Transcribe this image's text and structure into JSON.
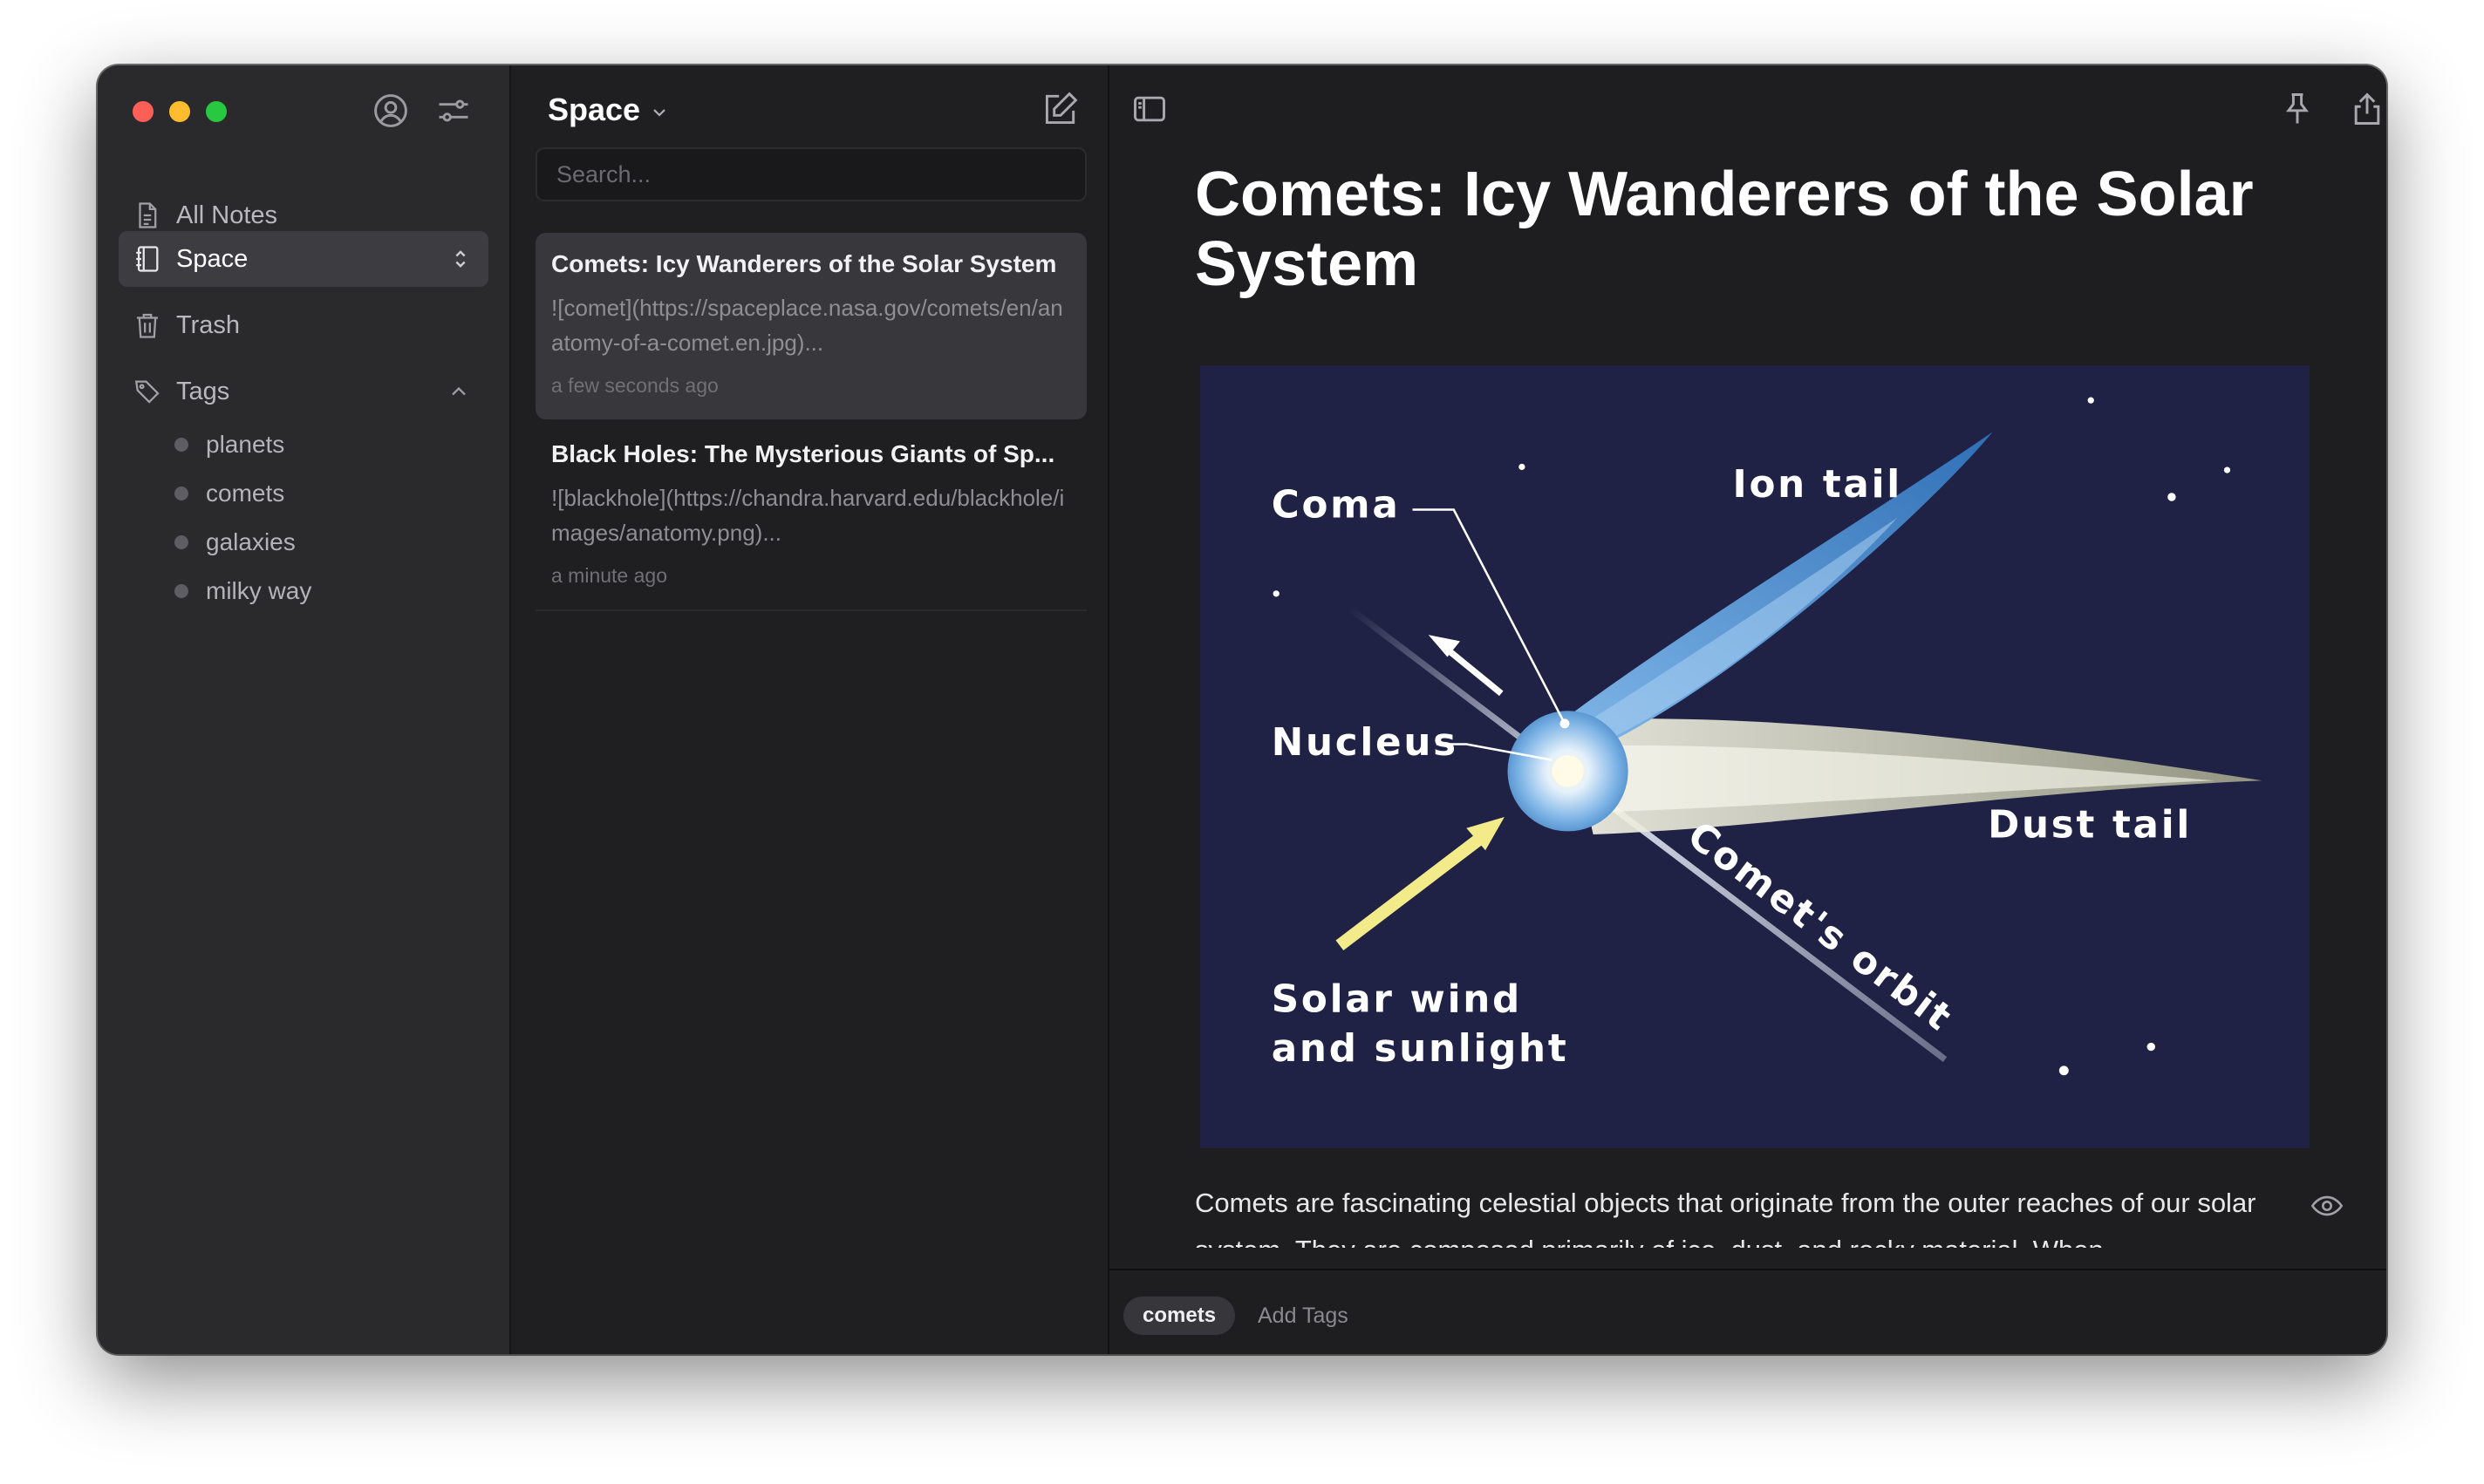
{
  "window": {
    "traffic_lights": [
      "close",
      "minimize",
      "zoom"
    ]
  },
  "sidebar": {
    "header_icons": [
      "account-icon",
      "settings-sliders-icon"
    ],
    "items": [
      {
        "label": "All Notes",
        "icon": "document-icon"
      },
      {
        "label": "Space",
        "icon": "notebook-icon",
        "active": true
      },
      {
        "label": "Trash",
        "icon": "trash-icon"
      }
    ],
    "tags_header": "Tags",
    "tags": [
      "planets",
      "comets",
      "galaxies",
      "milky way"
    ]
  },
  "notes_list": {
    "title": "Space",
    "search_placeholder": "Search...",
    "notes": [
      {
        "title": "Comets: Icy Wanderers of the Solar System",
        "excerpt": "![comet](https://spaceplace.nasa.gov/comets/en/anatomy-of-a-comet.en.jpg)...",
        "time": "a few seconds ago",
        "selected": true
      },
      {
        "title": "Black Holes: The Mysterious Giants of Sp...",
        "excerpt": "![blackhole](https://chandra.harvard.edu/blackhole/images/anatomy.png)...",
        "time": "a minute ago",
        "selected": false
      }
    ]
  },
  "editor": {
    "toolbar_icons": [
      "sidebar-toggle-icon",
      "pin-icon",
      "share-icon",
      "more-icon"
    ],
    "title": "Comets: Icy Wanderers of the Solar System",
    "image_labels": {
      "coma": "Coma",
      "ion_tail": "Ion tail",
      "nucleus": "Nucleus",
      "dust_tail": "Dust tail",
      "orbit": "Comet's orbit",
      "solar_wind_1": "Solar wind",
      "solar_wind_2": "and sunlight"
    },
    "body_text": "Comets are fascinating celestial objects that originate from the outer reaches of our solar system. They are composed primarily of ice, dust, and rocky material. When",
    "footer": {
      "tag": "comets",
      "add_tags": "Add Tags"
    }
  },
  "colors": {
    "window_bg": "#1e1e20",
    "sidebar_bg": "#2a2a2d",
    "image_bg": "#1f2145",
    "ion_tail": "#3f82c4",
    "solar_wind": "#f3eb8a"
  }
}
